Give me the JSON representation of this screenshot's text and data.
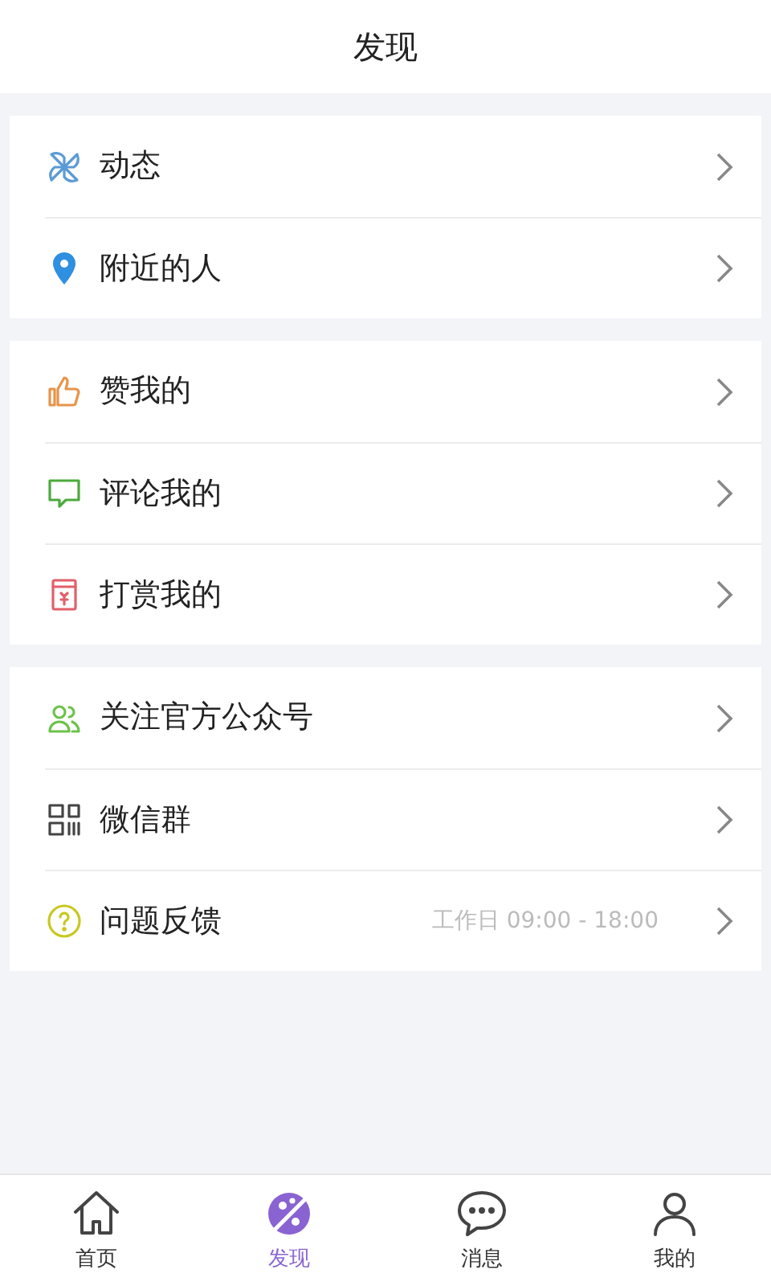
{
  "header": {
    "title": "发现"
  },
  "groups": [
    {
      "items": [
        {
          "kind": "pinwheel",
          "label": "动态"
        },
        {
          "kind": "pin",
          "label": "附近的人"
        }
      ]
    },
    {
      "items": [
        {
          "kind": "thumb",
          "label": "赞我的"
        },
        {
          "kind": "chat",
          "label": "评论我的"
        },
        {
          "kind": "reward",
          "label": "打赏我的"
        }
      ]
    },
    {
      "items": [
        {
          "kind": "people",
          "label": "关注官方公众号"
        },
        {
          "kind": "qr",
          "label": "微信群"
        },
        {
          "kind": "question",
          "label": "问题反馈",
          "note": "工作日 09:00 - 18:00"
        }
      ]
    }
  ],
  "tabs": [
    {
      "kind": "home",
      "label": "首页",
      "selected": false
    },
    {
      "kind": "planet",
      "label": "发现",
      "selected": true
    },
    {
      "kind": "message",
      "label": "消息",
      "selected": false
    },
    {
      "kind": "user",
      "label": "我的",
      "selected": false
    }
  ]
}
